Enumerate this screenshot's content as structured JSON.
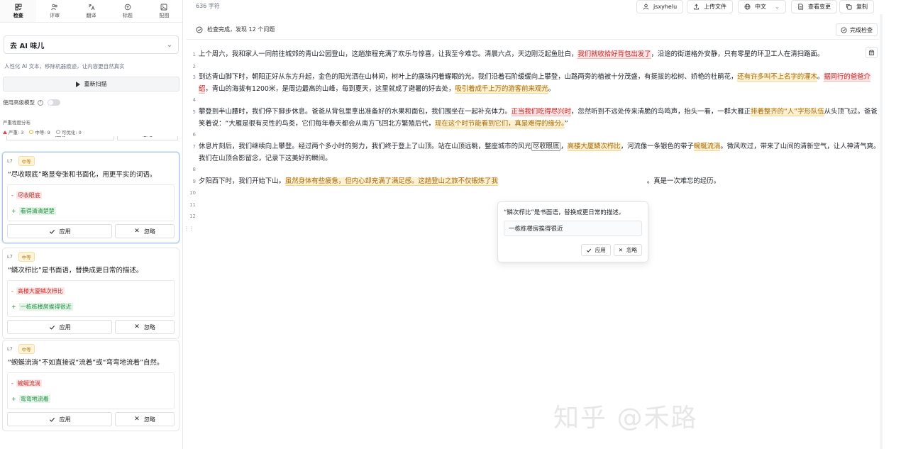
{
  "nav": {
    "tabs": [
      {
        "label": "检查",
        "icon": "check-grid-icon"
      },
      {
        "label": "评审",
        "icon": "users-icon"
      },
      {
        "label": "翻译",
        "icon": "translate-icon"
      },
      {
        "label": "标题",
        "icon": "title-icon"
      },
      {
        "label": "配图",
        "icon": "image-icon"
      }
    ]
  },
  "sidebar": {
    "mode_selected": "去 AI 味儿",
    "mode_desc": "人性化 AI 文本，移除机器痕迹，让内容更自然真实",
    "rescan_label": "重新扫描",
    "advanced_label": "使用高级模型",
    "distribution_title": "严重程度分布",
    "distribution": {
      "severe": "严重: 3",
      "medium": "中等: 9",
      "optional": "可优化: 0"
    },
    "ghost_apply": "应用",
    "ghost_ignore": "忽略",
    "cards": [
      {
        "line": "L7",
        "severity": "中等",
        "message": "“尽收眼底”略显夸张和书面化，用更平实的词语。",
        "del": "尽收眼底",
        "add": "看得清清楚楚",
        "apply": "应用",
        "ignore": "忽略"
      },
      {
        "line": "L7",
        "severity": "中等",
        "message": "“鳞次栉比”是书面语，替换成更日常的描述。",
        "del": "高楼大厦鳞次栉比",
        "add": "一栋栋楼房挨得很近",
        "apply": "应用",
        "ignore": "忽略"
      },
      {
        "line": "L7",
        "severity": "中等",
        "message": "“蜿蜒流淌”不如直接说“流着”或“弯弯地流着”自然。",
        "del": "蜿蜒流淌",
        "add": "弯弯地流着",
        "apply": "应用",
        "ignore": "忽略"
      }
    ]
  },
  "toolbar": {
    "char_count": "636 字符",
    "user": "jsxyhelu",
    "upload": "上传文件",
    "language": "中文",
    "view_changes": "查看变更",
    "copy": "复制"
  },
  "status": {
    "message": "检查完成，发现 12 个问题",
    "done_label": "完成检查"
  },
  "editor": {
    "line_numbers": [
      "1",
      "2",
      "3",
      "4",
      "5",
      "6",
      "7",
      "8",
      "9",
      "10",
      "11",
      "12"
    ],
    "p1": {
      "a": "上个周六，我和家人一同前往城郊的青山公园登山，这趟旅程充满了欢乐与惊喜，让我至今难忘。清晨六点，天边刚泛起鱼肚白，",
      "h1": "我们就收拾好背包出发了",
      "b": "，沿途的街道格外安静，只有零星的环卫工人在清扫路面。"
    },
    "p2": {
      "a": "到达青山脚下时，朝阳正好从东方升起，金色的阳光洒在山林间，树叶上的露珠闪着耀眼的光。我们沿着石阶缓缓向上攀登，山路两旁的植被十分茂盛，有挺拔的松树、娇艳的杜鹃花，",
      "h1": "还有许多叫不上名字的灌木",
      "b": "。",
      "h2": "据同行的爸爸介",
      "c": "绍",
      "d": "，青山的海拔有1200米，是周边最高的山峰，每到夏天，这里就成了避暑的好去处，",
      "h3": "吸引着成千上万的游客前来观光",
      "e": "。"
    },
    "p3": {
      "a": "攀登到半山腰时，我们停下脚步休息。爸爸从背包里拿出准备好的水果和面包，我们围坐在一起补充体力。",
      "h1": "正当我们吃得尽兴时",
      "b": "，忽然听到不远处传来清脆的鸟鸣声，抬头一看，一群大雁正",
      "h2": "排着整齐的“人”字形队伍",
      "c": "从头顶飞过。爸爸",
      "d": "笑着说：“大雁是很有灵性的鸟类，它们每年春天都会从南方飞回北方繁殖后代，",
      "h3": "现在这个时节能看到它们，真是难得的缘分。",
      "e": "”"
    },
    "p4": {
      "a": "休息片刻后，我们继续向上攀登。经过两个多小时的努力，我们终于登上了山顶。站在山顶远眺，整座城市的风光",
      "sel": "尽收眼底",
      "b": "，",
      "h1": "高楼大厦鳞次栉比",
      "c": "，河流像一条银色的带子",
      "h2": "蜿蜒流淌",
      "d": "。微风吹过，带来了山间的清新空气，让人神清气爽。",
      "e": "我们在山顶合影留念，记录下这美好的瞬间。"
    },
    "p5": {
      "a": "夕阳西下时，我们开始下山。",
      "h1": "虽然身体有些疲惫，但内心却充满了满足感。",
      "h2": "这趟登山之旅不仅锻炼了我",
      "b": "。真是一次难忘的经历。"
    }
  },
  "popover": {
    "message": "“鳞次栉比”是书面语，替换成更日常的描述。",
    "suggestion": "一栋栋楼房挨得很近",
    "apply": "应用",
    "ignore": "忽略"
  },
  "watermark": "知乎 @禾路"
}
